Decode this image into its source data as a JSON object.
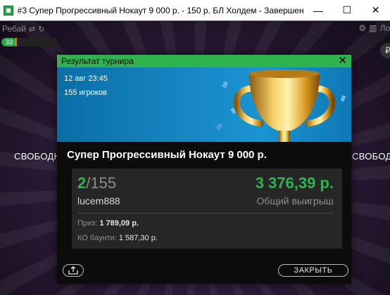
{
  "window": {
    "title": "#3 Супер Прогрессивный Нокаут 9 000 р. - 150 р. БЛ Холдем - Завершен",
    "minimize_glyph": "—",
    "maximize_glyph": "☐",
    "close_glyph": "✕"
  },
  "table": {
    "rebuy_label": "Ребай",
    "side_left": "СВОБОДН",
    "side_right": "СВОБОДН",
    "right_edge_label": "Ло",
    "player_count_badge": "33",
    "player_count_fill_fraction": 0.26
  },
  "dialog": {
    "header_title": "Результат турнира",
    "close_glyph": "✕",
    "date": "12 авг 23:45",
    "players": "155 игроков",
    "tournament_name": "Супер Прогрессивный Нокаут 9 000 р.",
    "place": "2",
    "place_total": "/155",
    "username": "lucem888",
    "winnings": "3 376,39 р.",
    "winnings_label": "Общий выигрыш",
    "prize_label": "Приз:",
    "prize_value": "1 789,09 р.",
    "ko_label": "КО баунти:",
    "ko_value": "1 587,30 р.",
    "close_button": "ЗАКРЫТЬ"
  },
  "colors": {
    "accent_green": "#2fb34f",
    "hero_blue": "#1787c4",
    "trophy_gold": "#e0a92a"
  },
  "icons": [
    "app-icon",
    "repeat-icon",
    "refresh-icon",
    "gear-icon",
    "chart-icon",
    "share-icon",
    "trophy-icon",
    "close-icon"
  ]
}
